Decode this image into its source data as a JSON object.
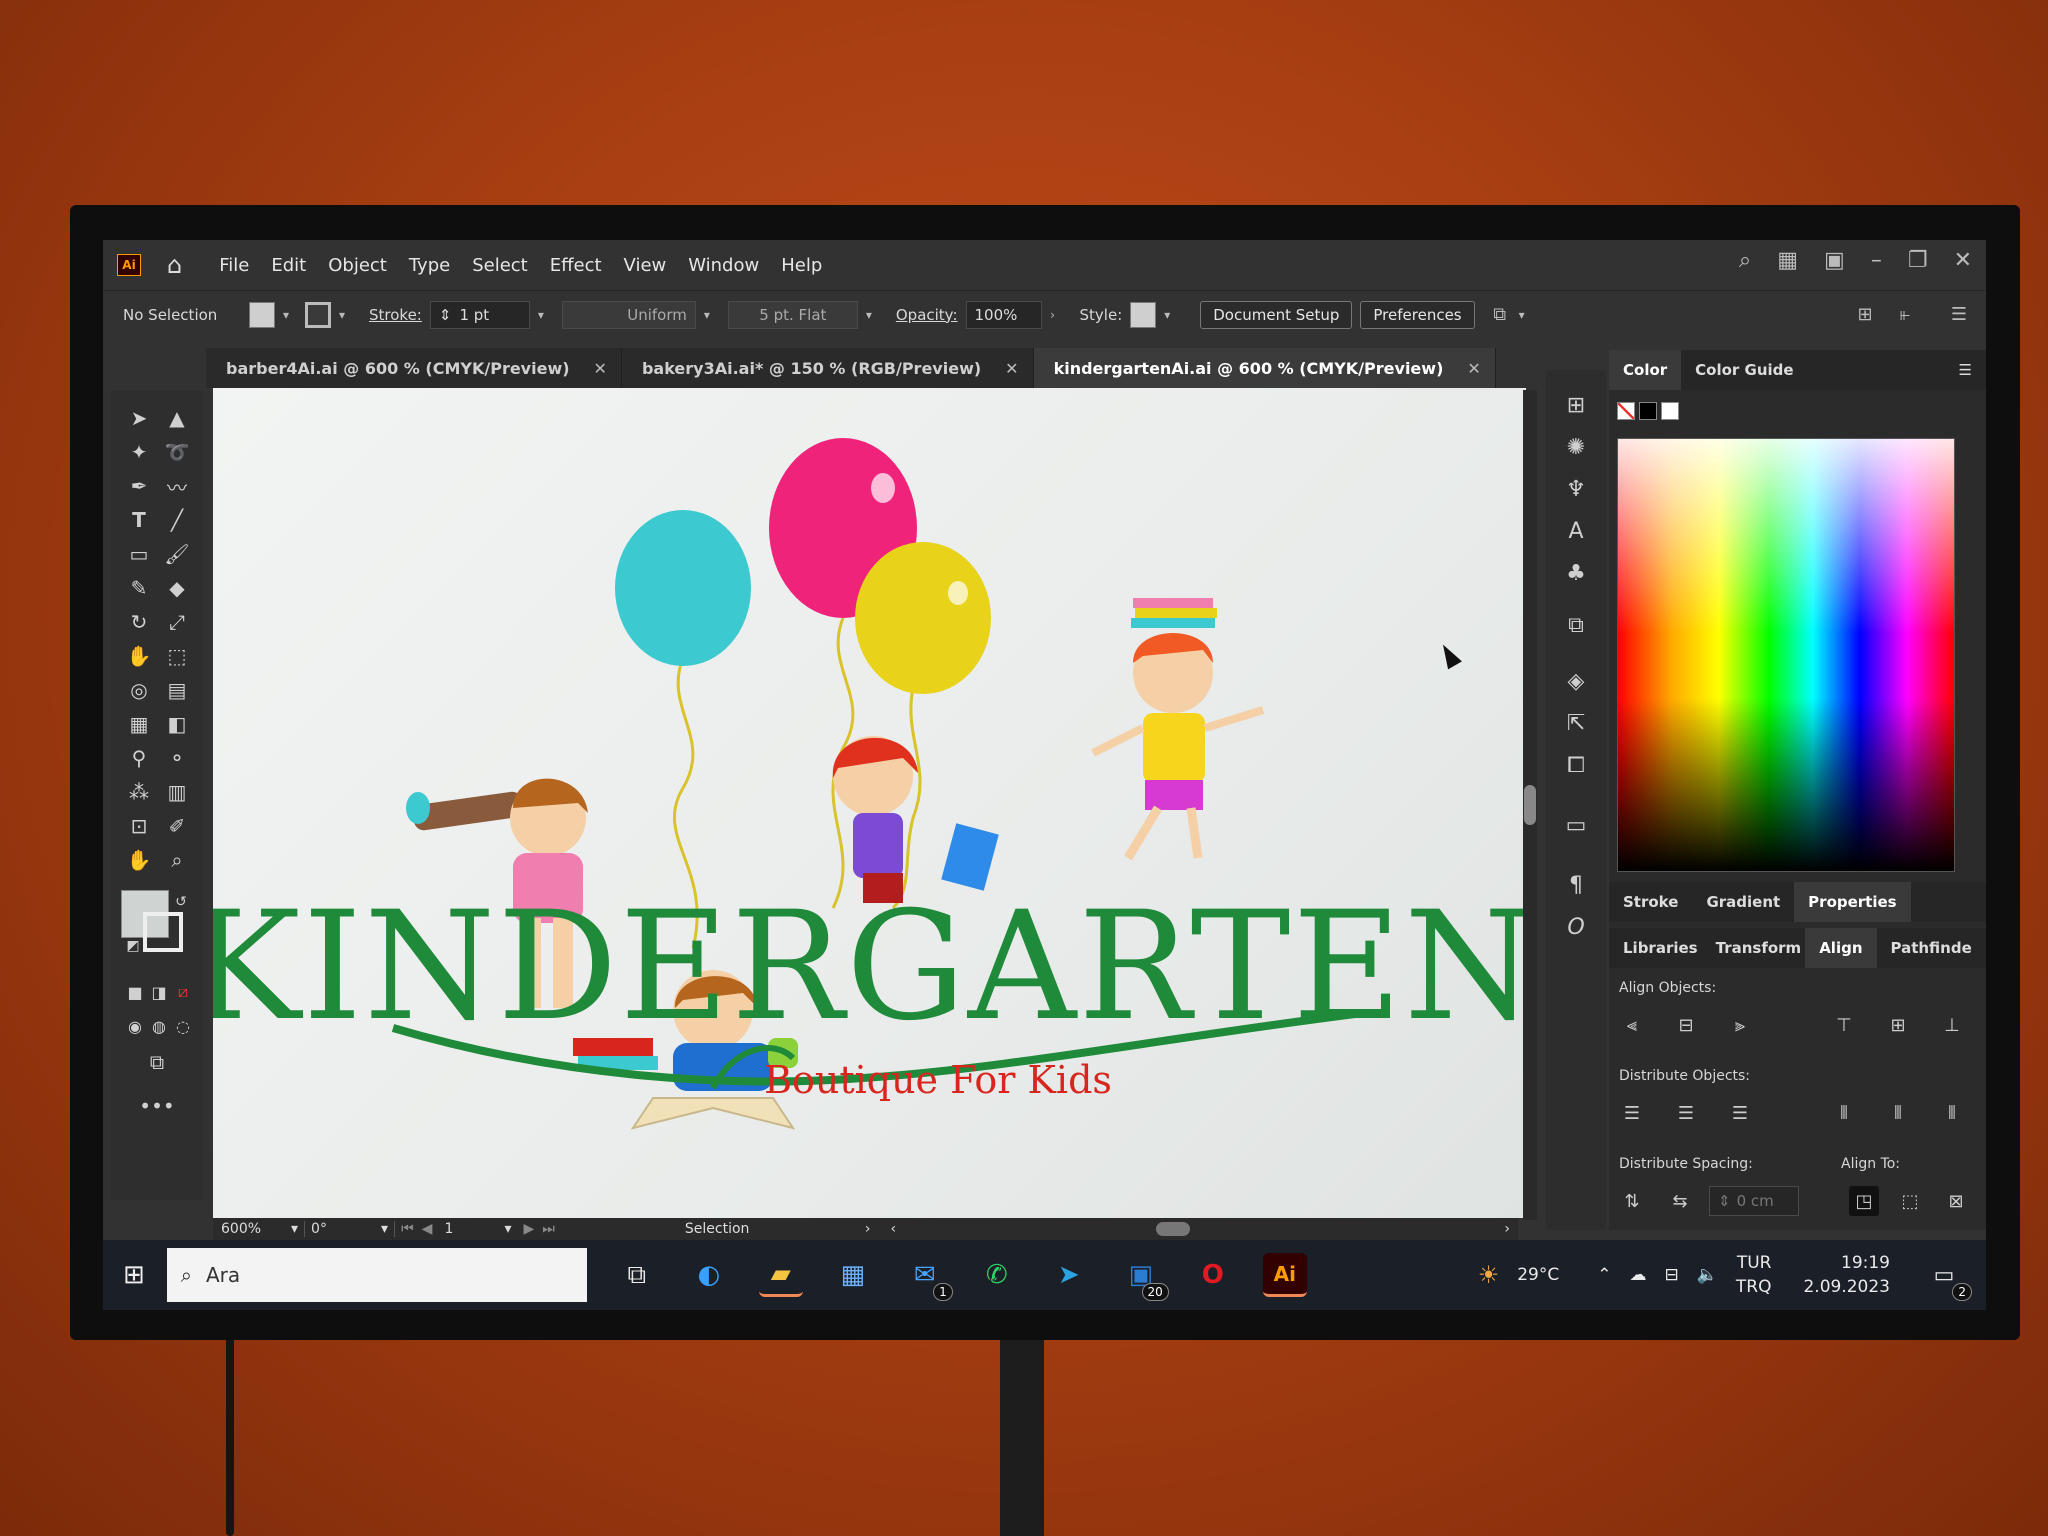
{
  "app": {
    "logo": "Ai"
  },
  "menu": [
    "File",
    "Edit",
    "Object",
    "Type",
    "Select",
    "Effect",
    "View",
    "Window",
    "Help"
  ],
  "control_bar": {
    "selection_state": "No Selection",
    "stroke_label": "Stroke:",
    "stroke_value": "1 pt",
    "stroke_profile": "Uniform",
    "brush": "5 pt. Flat",
    "opacity_label": "Opacity:",
    "opacity_value": "100%",
    "style_label": "Style:",
    "document_setup": "Document Setup",
    "preferences": "Preferences"
  },
  "tabs": [
    {
      "label": "barber4Ai.ai @ 600 % (CMYK/Preview)",
      "active": false
    },
    {
      "label": "bakery3Ai.ai* @ 150 % (RGB/Preview)",
      "active": false
    },
    {
      "label": "kindergartenAi.ai @ 600 % (CMYK/Preview)",
      "active": true
    }
  ],
  "artwork": {
    "title": "KINDERGARTEN",
    "subtitle": "Boutique For Kids",
    "colors": {
      "title": "#1f8a3a",
      "subtitle": "#d8261f",
      "balloon_pink": "#f0237a",
      "balloon_cyan": "#3cc9d0",
      "balloon_yellow": "#e8d21a"
    }
  },
  "status_bar": {
    "zoom": "600%",
    "rotation": "0°",
    "artboard": "1",
    "tool": "Selection"
  },
  "color_panel": {
    "tabs": [
      "Color",
      "Color Guide"
    ]
  },
  "props_tabs": [
    "Stroke",
    "Gradient",
    "Properties"
  ],
  "align_tabs": [
    "Libraries",
    "Transform",
    "Align",
    "Pathfinde"
  ],
  "align_panel": {
    "align_objects": "Align Objects:",
    "distribute_objects": "Distribute Objects:",
    "distribute_spacing": "Distribute Spacing:",
    "align_to": "Align To:",
    "spacing_value": "0 cm"
  },
  "taskbar": {
    "search_placeholder": "Ara",
    "weather": "29°C",
    "lang_top": "TUR",
    "lang_bottom": "TRQ",
    "time": "19:19",
    "date": "2.09.2023",
    "mail_badge": "1",
    "outlook_badge": "20",
    "notif_badge": "2"
  }
}
